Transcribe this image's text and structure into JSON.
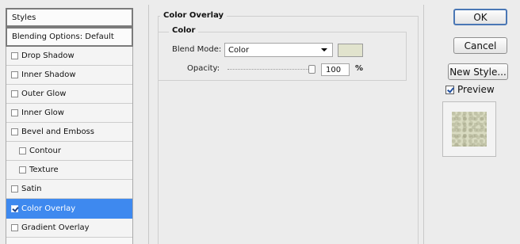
{
  "styles_panel": {
    "header": "Styles",
    "blending_options": "Blending Options: Default",
    "items": [
      {
        "label": "Drop Shadow",
        "checked": false
      },
      {
        "label": "Inner Shadow",
        "checked": false
      },
      {
        "label": "Outer Glow",
        "checked": false
      },
      {
        "label": "Inner Glow",
        "checked": false
      },
      {
        "label": "Bevel and Emboss",
        "checked": false
      },
      {
        "label": "Contour",
        "checked": false
      },
      {
        "label": "Texture",
        "checked": false
      },
      {
        "label": "Satin",
        "checked": false
      },
      {
        "label": "Color Overlay",
        "checked": true
      },
      {
        "label": "Gradient Overlay",
        "checked": false
      }
    ]
  },
  "color_overlay": {
    "section_title": "Color Overlay",
    "group_title": "Color",
    "blend_mode_label": "Blend Mode:",
    "blend_mode_value": "Color",
    "overlay_color": "#e1e3cd",
    "opacity_label": "Opacity:",
    "opacity_value": "100",
    "opacity_unit": "%"
  },
  "buttons": {
    "ok": "OK",
    "cancel": "Cancel",
    "new_style": "New Style..."
  },
  "preview": {
    "label": "Preview",
    "checked": true
  },
  "colors": {
    "selection": "#3e89ef",
    "panel_bg": "#ececec"
  }
}
